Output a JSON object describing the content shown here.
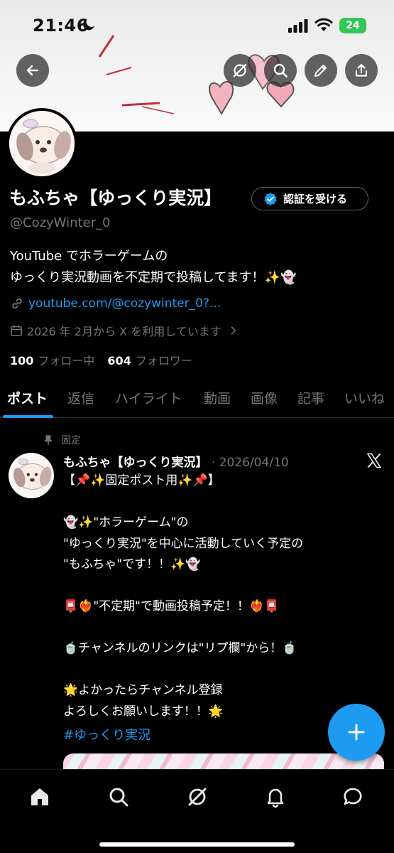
{
  "status_bar": {
    "time": "21:46",
    "battery": "24"
  },
  "header": {
    "icons": [
      "back-arrow-icon",
      "grok-icon",
      "search-icon",
      "edit-icon",
      "share-icon"
    ]
  },
  "profile": {
    "name": "もふちゃ【ゆっくり実況】",
    "verify_label": "認証を受ける",
    "handle": "@CozyWinter_0",
    "bio_line1": "YouTube でホラーゲームの",
    "bio_line2": "ゆっくり実況動画を不定期で投稿してます！✨👻",
    "link": "youtube.com/@cozywinter_0?...",
    "joined": "2026 年 2月から X を利用しています",
    "following_count": "100",
    "following_label": "フォロー中",
    "followers_count": "604",
    "followers_label": "フォロワー"
  },
  "tabs": [
    "ポスト",
    "返信",
    "ハイライト",
    "動画",
    "画像",
    "記事",
    "いいね"
  ],
  "active_tab": "ポスト",
  "pinned_post": {
    "pinned_label": "固定",
    "author": "もふちゃ【ゆっくり実況】",
    "date": "· 2026/04/10",
    "body": "【📌✨固定ポスト用✨📌】\n\n👻✨\"ホラーゲーム\"の\n\"ゆっくり実況\"を中心に活動していく予定の\n\"もふちゃ\"です！！✨👻\n\n📮❤️‍🔥\"不定期\"で動画投稿予定！！❤️‍🔥📮\n\n🍵チャンネルのリンクは\"リプ欄\"から！🍵\n\n🌟よかったらチャンネル登録\nよろしくお願いします！！🌟",
    "hashtag": "#ゆっくり実況"
  },
  "fab": {
    "icon": "plus-icon"
  },
  "bottom_nav": [
    "home-icon",
    "search-icon",
    "grok-icon",
    "notifications-icon",
    "messages-icon"
  ],
  "colors": {
    "accent": "#1d9bf0",
    "background": "#000000",
    "muted": "#71767b"
  }
}
